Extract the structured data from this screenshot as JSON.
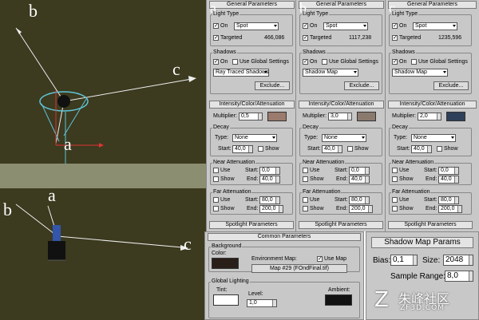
{
  "viewport_top": {
    "labels": {
      "b": "b",
      "c": "c",
      "a": "a"
    }
  },
  "viewport_bottom": {
    "labels": {
      "b": "b",
      "a": "a",
      "c": "c"
    }
  },
  "columns": [
    {
      "tag": "a",
      "rollout_title": "General Parameters",
      "light_type_label": "Light Type",
      "on_label": "On",
      "light_type": "Spot",
      "targeted_label": "Targeted",
      "target_distance": "466,086",
      "shadows_label": "Shadows",
      "shadow_on_label": "On",
      "use_global_label": "Use Global Settings",
      "shadow_type": "Ray Traced Shadows",
      "exclude_label": "Exclude...",
      "intensity_title": "Intensity/Color/Attenuation",
      "multiplier_label": "Multiplier:",
      "multiplier": "0,5",
      "color": "#9a7b6e",
      "decay_label": "Decay",
      "type_label": "Type:",
      "decay_type": "None",
      "start_label": "Start:",
      "decay_start": "40,0",
      "show_label": "Show",
      "near_label": "Near Attenuation",
      "use_label": "Use",
      "show2_label": "Show",
      "nstart_label": "Start:",
      "near_start": "0,0",
      "end_label": "End:",
      "near_end": "40,0",
      "far_label": "Far Attenuation",
      "fuse_label": "Use",
      "fshow_label": "Show",
      "fstart_label": "Start:",
      "far_start": "80,0",
      "fend_label": "End:",
      "far_end": "200,0",
      "spot_title": "Spotlight Parameters"
    },
    {
      "tag": "b",
      "rollout_title": "General Parameters",
      "light_type_label": "Light Type",
      "on_label": "On",
      "light_type": "Spot",
      "targeted_label": "Targeted",
      "target_distance": "1117,238",
      "shadows_label": "Shadows",
      "shadow_on_label": "On",
      "use_global_label": "Use Global Settings",
      "shadow_type": "Shadow Map",
      "exclude_label": "Exclude...",
      "intensity_title": "Intensity/Color/Attenuation",
      "multiplier_label": "Multiplier:",
      "multiplier": "3,0",
      "color": "#8a7a6e",
      "decay_label": "Decay",
      "type_label": "Type:",
      "decay_type": "None",
      "start_label": "Start:",
      "decay_start": "40,0",
      "show_label": "Show",
      "near_label": "Near Attenuation",
      "use_label": "Use",
      "show2_label": "Show",
      "nstart_label": "Start:",
      "near_start": "0,0",
      "end_label": "End:",
      "near_end": "40,0",
      "far_label": "Far Attenuation",
      "fuse_label": "Use",
      "fshow_label": "Show",
      "fstart_label": "Start:",
      "far_start": "80,0",
      "fend_label": "End:",
      "far_end": "200,0",
      "spot_title": "Spotlight Parameters"
    },
    {
      "tag": "c",
      "rollout_title": "General Parameters",
      "light_type_label": "Light Type",
      "on_label": "On",
      "light_type": "Spot",
      "targeted_label": "Targeted",
      "target_distance": "1235,596",
      "shadows_label": "Shadows",
      "shadow_on_label": "On",
      "use_global_label": "Use Global Settings",
      "shadow_type": "Shadow Map",
      "exclude_label": "Exclude...",
      "intensity_title": "Intensity/Color/Attenuation",
      "multiplier_label": "Multiplier:",
      "multiplier": "2,0",
      "color": "#2e3f5a",
      "decay_label": "Decay",
      "type_label": "Type:",
      "decay_type": "None",
      "start_label": "Start:",
      "decay_start": "40,0",
      "show_label": "Show",
      "near_label": "Near Attenuation",
      "use_label": "Use",
      "show2_label": "Show",
      "nstart_label": "Start:",
      "near_start": "0,0",
      "end_label": "End:",
      "near_end": "40,0",
      "far_label": "Far Attenuation",
      "fuse_label": "Use",
      "fshow_label": "Show",
      "fstart_label": "Start:",
      "far_start": "80,0",
      "fend_label": "End:",
      "far_end": "200,0",
      "spot_title": "Spotlight Parameters"
    }
  ],
  "common": {
    "title": "Common Parameters",
    "background_label": "Background",
    "color_label": "Color:",
    "bg_color": "#2a1e18",
    "env_map_label": "Environment Map:",
    "use_map_label": "Use Map",
    "map_name": "Map #29 (FOndFinal.tif)",
    "global_lighting_label": "Global Lighting",
    "tint_label": "Tint:",
    "level_label": "Level:",
    "level": "1,0",
    "ambient_label": "Ambient:",
    "tint_color": "#ffffff",
    "ambient_color": "#111111"
  },
  "shadow_map": {
    "title": "Shadow Map Params",
    "bias_label": "Bias:",
    "bias": "0,1",
    "size_label": "Size:",
    "size": "2048",
    "sample_label": "Sample Range:",
    "sample_range": "8,0"
  },
  "watermark": {
    "text1": "朱峰社区",
    "text2": "ZF3D.COM"
  }
}
